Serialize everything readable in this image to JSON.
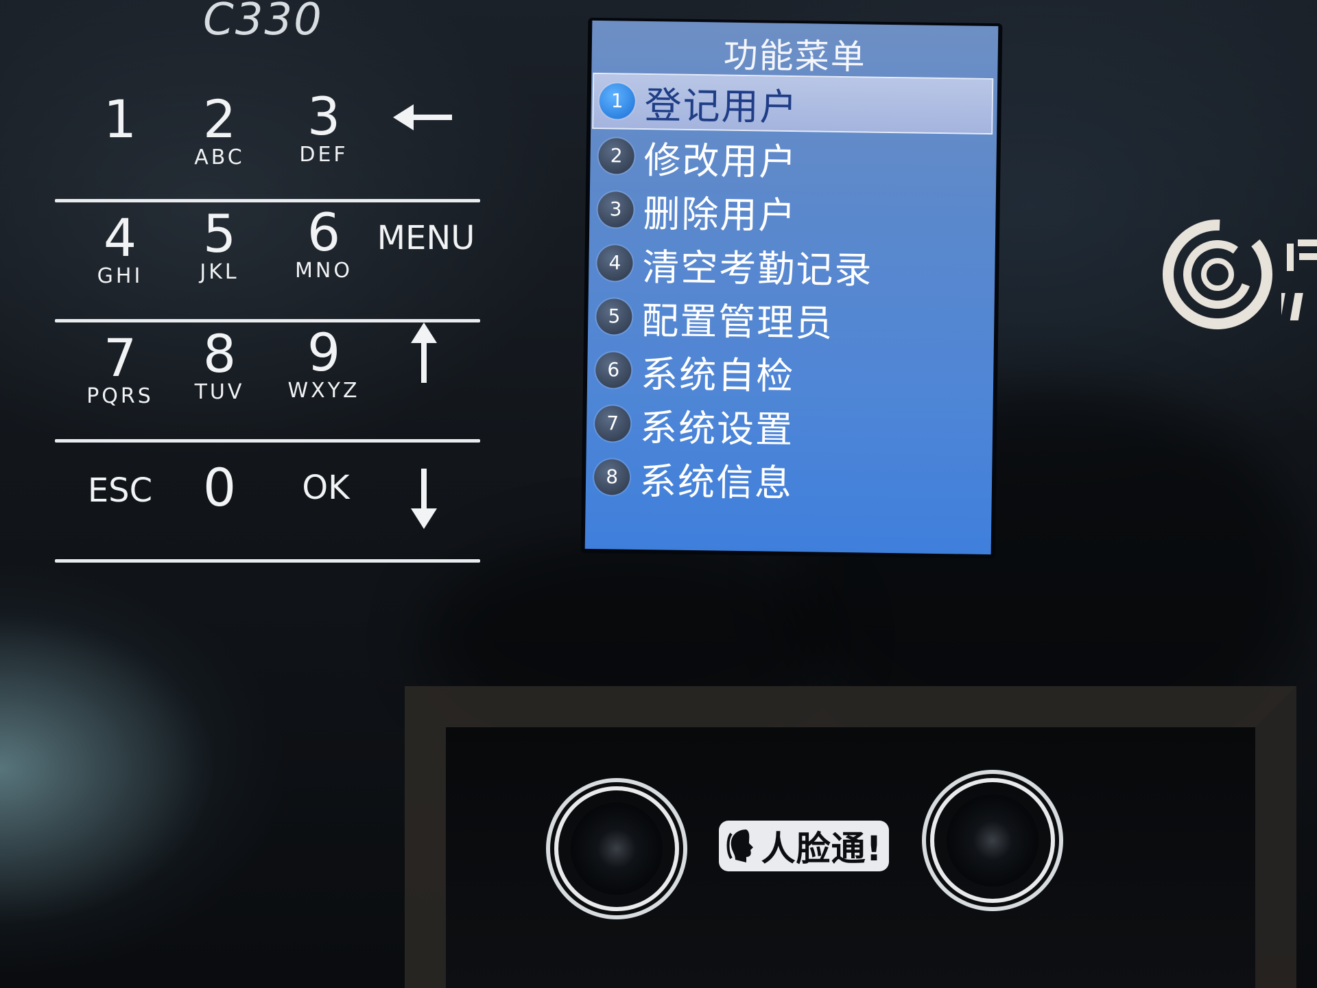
{
  "device": {
    "model": "C330",
    "logo_text": "人脸通!"
  },
  "keypad": {
    "rows": [
      [
        {
          "digit": "1",
          "letters": ""
        },
        {
          "digit": "2",
          "letters": "ABC"
        },
        {
          "digit": "3",
          "letters": "DEF"
        },
        {
          "icon": "backspace-arrow-icon"
        }
      ],
      [
        {
          "digit": "4",
          "letters": "GHI"
        },
        {
          "digit": "5",
          "letters": "JKL"
        },
        {
          "digit": "6",
          "letters": "MNO"
        },
        {
          "word": "MENU"
        }
      ],
      [
        {
          "digit": "7",
          "letters": "PQRS"
        },
        {
          "digit": "8",
          "letters": "TUV"
        },
        {
          "digit": "9",
          "letters": "WXYZ"
        },
        {
          "icon": "up-arrow-icon"
        }
      ],
      [
        {
          "word": "ESC"
        },
        {
          "digit": "0",
          "letters": ""
        },
        {
          "word": "OK"
        },
        {
          "icon": "down-arrow-icon"
        }
      ]
    ]
  },
  "screen": {
    "title": "功能菜单",
    "selected_index": 0,
    "items": [
      {
        "num": "1",
        "label": "登记用户"
      },
      {
        "num": "2",
        "label": "修改用户"
      },
      {
        "num": "3",
        "label": "删除用户"
      },
      {
        "num": "4",
        "label": "清空考勤记录"
      },
      {
        "num": "5",
        "label": "配置管理员"
      },
      {
        "num": "6",
        "label": "系统自检"
      },
      {
        "num": "7",
        "label": "系统设置"
      },
      {
        "num": "8",
        "label": "系统信息"
      }
    ]
  },
  "colors": {
    "screen_blue": "#4f86d6",
    "selected_row": "#a4b4de",
    "selected_badge": "#1a6fd6",
    "key_text": "#f1f3f5"
  }
}
